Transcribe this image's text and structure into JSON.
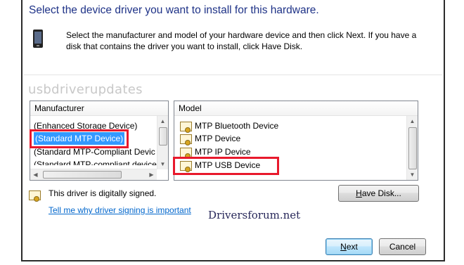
{
  "dialog": {
    "heading": "Select the device driver you want to install for this hardware.",
    "description": "Select the manufacturer and model of your hardware device and then click Next. If you have a disk that contains the driver you want to install, click Have Disk."
  },
  "watermarks": {
    "top": "usbdriverupdates",
    "bottom": "Driversforum.net"
  },
  "manufacturer": {
    "header": "Manufacturer",
    "items": [
      "(Enhanced Storage Device)",
      "(Standard MTP Device)",
      "(Standard MTP-Compliant Devic",
      "(Standard MTP-compliant device"
    ],
    "selected_index": 1
  },
  "model": {
    "header": "Model",
    "items": [
      "MTP Bluetooth Device",
      "MTP Device",
      "MTP IP Device",
      "MTP USB Device"
    ],
    "highlighted_index": 3
  },
  "signing": {
    "status": "This driver is digitally signed.",
    "link": "Tell me why driver signing is important"
  },
  "buttons": {
    "have_disk_ul": "H",
    "have_disk_rest": "ave Disk...",
    "next_ul": "N",
    "next_rest": "ext",
    "cancel": "Cancel"
  },
  "icons": {
    "device": "phone-icon",
    "certificate": "certificate-icon",
    "highlight_color": "#e8192c",
    "selection_color": "#3399ff"
  }
}
